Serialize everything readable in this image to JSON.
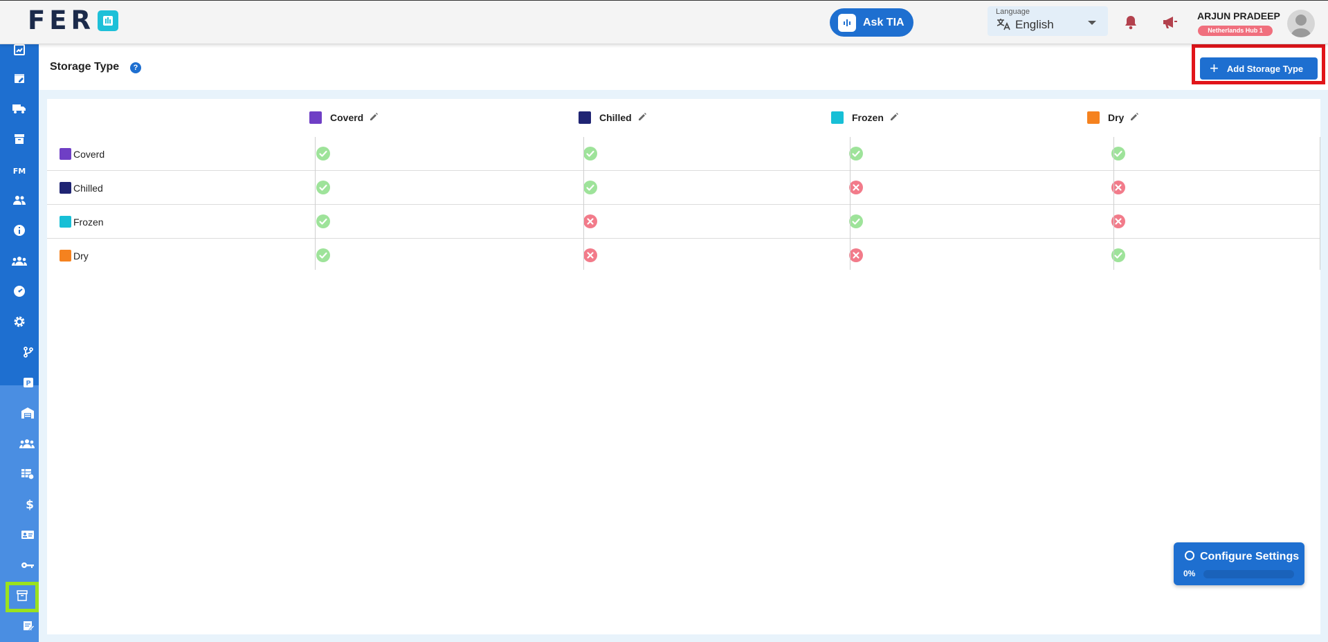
{
  "header": {
    "logo_text": "FER",
    "ask_label": "Ask TIA",
    "language_label": "Language",
    "language_value": "English",
    "user_name": "ARJUN PRADEEP",
    "hub": "Netherlands Hub 1"
  },
  "page": {
    "title": "Storage Type",
    "help": "?",
    "add_label": "Add Storage Type"
  },
  "storage_types": [
    {
      "name": "Coverd",
      "color": "#6f3fc5"
    },
    {
      "name": "Chilled",
      "color": "#1f2473"
    },
    {
      "name": "Frozen",
      "color": "#17bfd6"
    },
    {
      "name": "Dry",
      "color": "#f5821f"
    }
  ],
  "compatibility": [
    [
      true,
      true,
      true,
      true
    ],
    [
      true,
      true,
      false,
      false
    ],
    [
      true,
      false,
      true,
      false
    ],
    [
      true,
      false,
      false,
      true
    ]
  ],
  "config": {
    "title": "Configure Settings",
    "percent": "0%",
    "progress": 0
  },
  "colors": {
    "primary": "#1e6fd0",
    "check": "#9ee39a",
    "cross": "#f27b8a"
  }
}
